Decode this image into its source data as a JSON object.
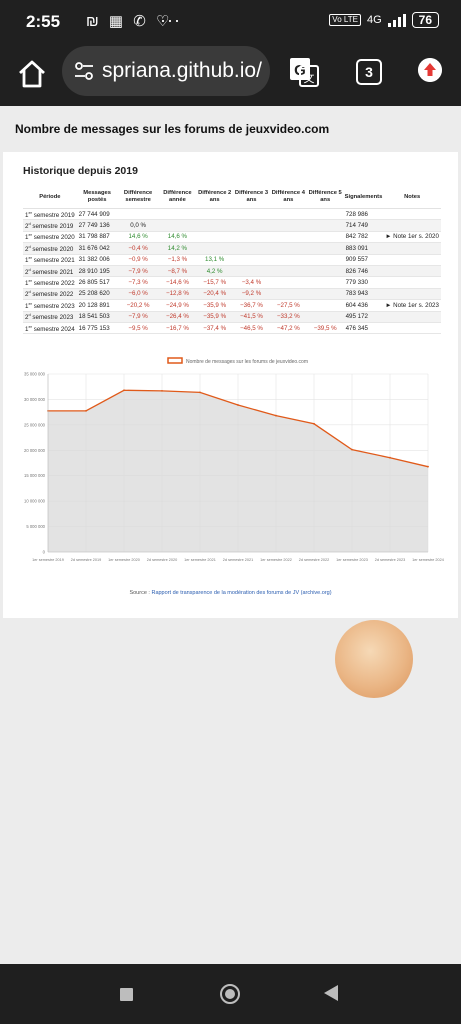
{
  "status": {
    "time": "2:55",
    "left_icons": "₪ ▦ ✆ ♡",
    "more": "···",
    "volte": "Vo LTE",
    "network": "4G",
    "battery": "76"
  },
  "browser": {
    "url": "spriana.github.io/",
    "tab_count": "3"
  },
  "page": {
    "title": "Nombre de messages sur les forums de jeuxvideo.com",
    "section_title": "Historique depuis 2019",
    "table": {
      "headers": [
        "Période",
        "Messages postés",
        "Différence semestre",
        "Différence année",
        "Différence 2 ans",
        "Différence 3 ans",
        "Différence 4 ans",
        "Différence 5 ans",
        "Signalements",
        "Notes"
      ],
      "rows": [
        {
          "ord": "1",
          "sup": "er",
          "rest": " semestre 2019",
          "messages": "27 744 909",
          "d1": "",
          "d2": "",
          "d3": "",
          "d4": "",
          "d5": "",
          "d6": "",
          "signalements": "728 986",
          "note": ""
        },
        {
          "ord": "2",
          "sup": "d",
          "rest": " semestre 2019",
          "messages": "27 749 136",
          "d1": "0,0 %",
          "d2": "",
          "d3": "",
          "d4": "",
          "d5": "",
          "d6": "",
          "signalements": "714 749",
          "note": ""
        },
        {
          "ord": "1",
          "sup": "er",
          "rest": " semestre 2020",
          "messages": "31 798 887",
          "d1": "14,6 %",
          "d2": "14,6 %",
          "d3": "",
          "d4": "",
          "d5": "",
          "d6": "",
          "signalements": "842 782",
          "note": "► Note 1er s. 2020"
        },
        {
          "ord": "2",
          "sup": "d",
          "rest": " semestre 2020",
          "messages": "31 676 042",
          "d1": "−0,4 %",
          "d2": "14,2 %",
          "d3": "",
          "d4": "",
          "d5": "",
          "d6": "",
          "signalements": "883 091",
          "note": ""
        },
        {
          "ord": "1",
          "sup": "er",
          "rest": " semestre 2021",
          "messages": "31 382 006",
          "d1": "−0,9 %",
          "d2": "−1,3 %",
          "d3": "13,1 %",
          "d4": "",
          "d5": "",
          "d6": "",
          "signalements": "909 557",
          "note": ""
        },
        {
          "ord": "2",
          "sup": "d",
          "rest": " semestre 2021",
          "messages": "28 910 195",
          "d1": "−7,9 %",
          "d2": "−8,7 %",
          "d3": "4,2 %",
          "d4": "",
          "d5": "",
          "d6": "",
          "signalements": "826 746",
          "note": ""
        },
        {
          "ord": "1",
          "sup": "er",
          "rest": " semestre 2022",
          "messages": "26 805 517",
          "d1": "−7,3 %",
          "d2": "−14,6 %",
          "d3": "−15,7 %",
          "d4": "−3,4 %",
          "d5": "",
          "d6": "",
          "signalements": "779 330",
          "note": ""
        },
        {
          "ord": "2",
          "sup": "d",
          "rest": " semestre 2022",
          "messages": "25 208 620",
          "d1": "−6,0 %",
          "d2": "−12,8 %",
          "d3": "−20,4 %",
          "d4": "−9,2 %",
          "d5": "",
          "d6": "",
          "signalements": "783 943",
          "note": ""
        },
        {
          "ord": "1",
          "sup": "er",
          "rest": " semestre 2023",
          "messages": "20 128 891",
          "d1": "−20,2 %",
          "d2": "−24,9 %",
          "d3": "−35,9 %",
          "d4": "−36,7 %",
          "d5": "−27,5 %",
          "d6": "",
          "signalements": "604 436",
          "note": "► Note 1er s. 2023"
        },
        {
          "ord": "2",
          "sup": "d",
          "rest": " semestre 2023",
          "messages": "18 541 503",
          "d1": "−7,9 %",
          "d2": "−26,4 %",
          "d3": "−35,9 %",
          "d4": "−41,5 %",
          "d5": "−33,2 %",
          "d6": "",
          "signalements": "495 172",
          "note": ""
        },
        {
          "ord": "1",
          "sup": "er",
          "rest": " semestre 2024",
          "messages": "16 775 153",
          "d1": "−9,5 %",
          "d2": "−16,7 %",
          "d3": "−37,4 %",
          "d4": "−46,5 %",
          "d5": "−47,2 %",
          "d6": "−39,5 %",
          "signalements": "476 345",
          "note": ""
        }
      ]
    },
    "source_prefix": "Source : ",
    "source_link": "Rapport de transparence de la modération des forums de JV (archive.org)"
  },
  "chart_data": {
    "type": "area",
    "series": [
      {
        "name": "Nombre de messages sur les forums de jeuxvideo.com",
        "values": [
          27744909,
          27749136,
          31798887,
          31676042,
          31382006,
          28910195,
          26805517,
          25208620,
          20128891,
          18541503,
          16775153
        ]
      }
    ],
    "x": [
      "1er semestre 2019",
      "2d semestre 2019",
      "1er semestre 2020",
      "2d semestre 2020",
      "1er semestre 2021",
      "2d semestre 2021",
      "1er semestre 2022",
      "2d semestre 2022",
      "1er semestre 2023",
      "2d semestre 2023",
      "1er semestre 2024"
    ],
    "y_ticks": [
      "0",
      "5 000 000",
      "10 000 000",
      "15 000 000",
      "20 000 000",
      "25 000 000",
      "30 000 000",
      "35 000 000"
    ],
    "ylim": [
      0,
      35000000
    ],
    "line_color": "#e05a1a",
    "fill_color": "#d9d9d9",
    "legend_position": "top"
  }
}
